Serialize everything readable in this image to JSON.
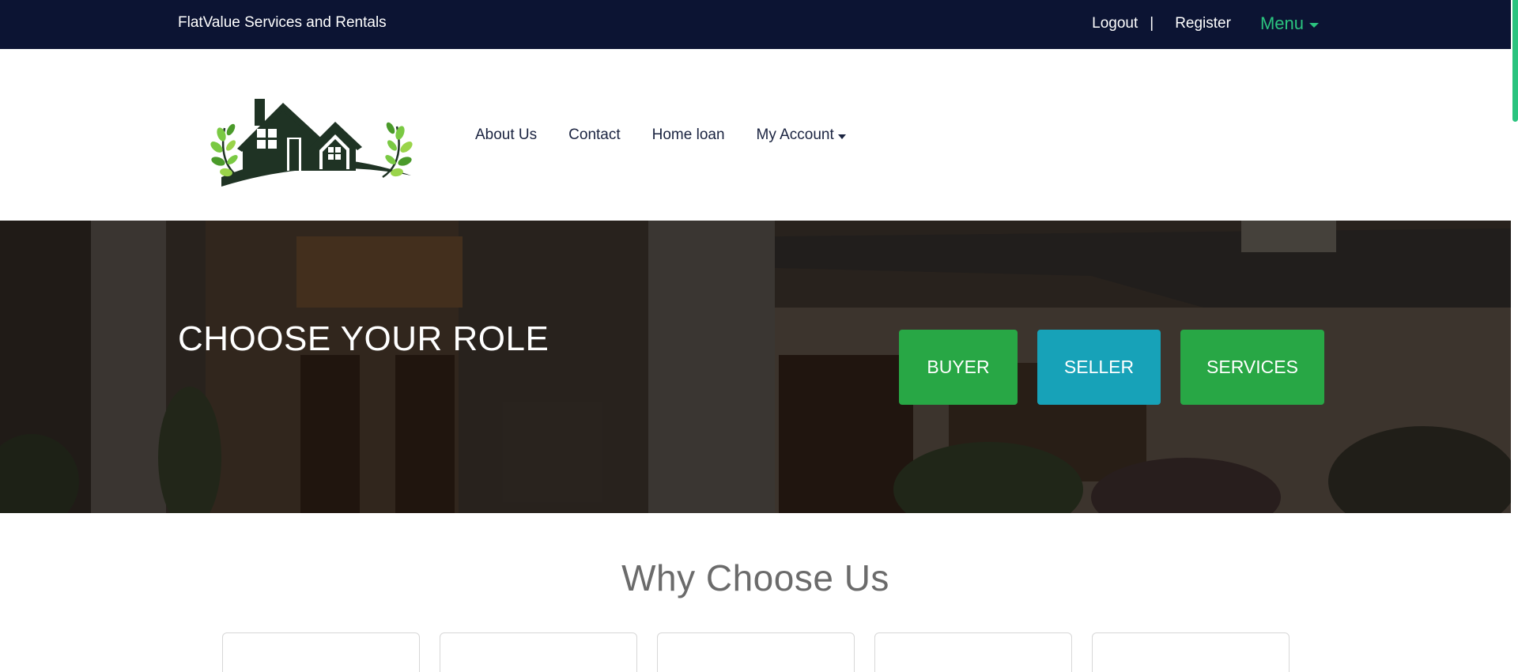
{
  "topbar": {
    "brand": "FlatValue Services and Rentals",
    "logout": "Logout",
    "separator": "|",
    "register": "Register",
    "menu": "Menu"
  },
  "nav": {
    "items": [
      "About Us",
      "Contact",
      "Home loan",
      "My Account"
    ]
  },
  "hero": {
    "title": "CHOOSE YOUR ROLE",
    "buttons": {
      "buyer": "BUYER",
      "seller": "SELLER",
      "services": "SERVICES"
    }
  },
  "why": {
    "title": "Why Choose Us"
  },
  "colors": {
    "topbar_bg": "#0c1433",
    "accent_green": "#2bc47f",
    "buyer_bg": "#28a745",
    "seller_bg": "#17a2b8",
    "services_bg": "#28a745",
    "logo_dark": "#1f3324",
    "leaf_green": "#7ac943"
  },
  "icons": {
    "menu_caret": "caret-down-icon",
    "account_caret": "caret-down-icon",
    "logo": "house-logo-icon"
  }
}
